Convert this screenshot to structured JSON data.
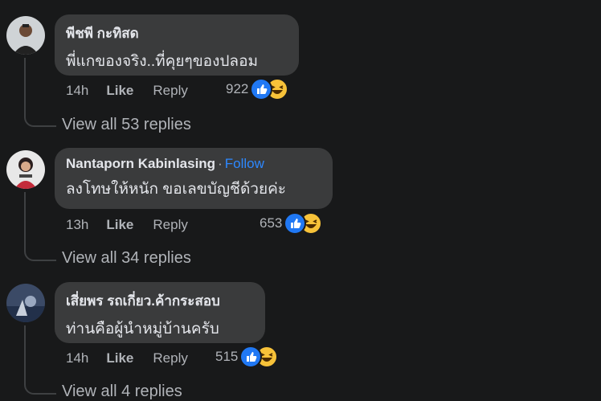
{
  "comments": [
    {
      "author": "พีชพี กะทิสด",
      "follow": "",
      "text": "พี่แกของจริง..ที่คุยๆของปลอม",
      "time": "14h",
      "like": "Like",
      "reply": "Reply",
      "reaction_count": "922",
      "view_replies": "View all 53 replies"
    },
    {
      "author": "Nantaporn Kabinlasing",
      "follow": "Follow",
      "text": "ลงโทษให้หนัก ขอเลขบัญชีด้วยค่ะ",
      "time": "13h",
      "like": "Like",
      "reply": "Reply",
      "reaction_count": "653",
      "view_replies": "View all 34 replies"
    },
    {
      "author": "เสี่ยพร รถเกี่ยว.ค้ากระสอบ",
      "follow": "",
      "text": "ท่านคือผู้นำหมู่บ้านครับ",
      "time": "14h",
      "like": "Like",
      "reply": "Reply",
      "reaction_count": "515",
      "view_replies": "View all 4 replies"
    }
  ],
  "reaction_icons": [
    "like-icon",
    "haha-icon"
  ],
  "colors": {
    "background": "#18191a",
    "bubble": "#3a3b3c",
    "link": "#2d88ff",
    "like": "#2078f4",
    "haha": "#f7c239"
  }
}
